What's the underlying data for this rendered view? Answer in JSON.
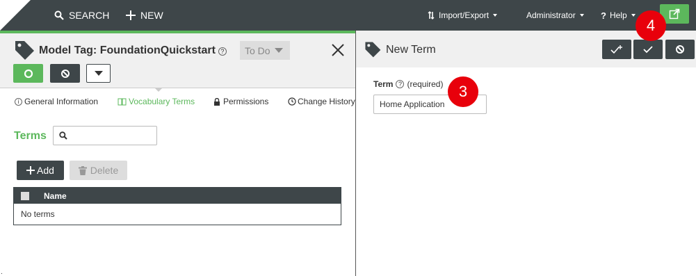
{
  "topbar": {
    "search_label": "SEARCH",
    "new_label": "NEW",
    "import_export_label": "Import/Export",
    "user_label": "Administrator",
    "help_label": "Help"
  },
  "left_panel": {
    "title": "Model Tag: FoundationQuickstart",
    "status": "To Do",
    "tabs": [
      {
        "label": "General Information",
        "icon": "info-icon"
      },
      {
        "label": "Vocabulary Terms",
        "icon": "book-icon",
        "active": true
      },
      {
        "label": "Permissions",
        "icon": "lock-icon"
      },
      {
        "label": "Change History",
        "icon": "clock-icon"
      }
    ],
    "terms_label": "Terms",
    "add_label": "Add",
    "delete_label": "Delete",
    "table": {
      "columns": [
        "Name"
      ],
      "empty_text": "No terms"
    }
  },
  "right_panel": {
    "title": "New Term",
    "field_label": "Term",
    "field_required": "(required)",
    "field_value": "Home Application"
  },
  "annotations": [
    "3",
    "4"
  ],
  "colors": {
    "topbar": "#3e4649",
    "accent_green": "#5cb85c",
    "badge_red": "#e8000b"
  }
}
